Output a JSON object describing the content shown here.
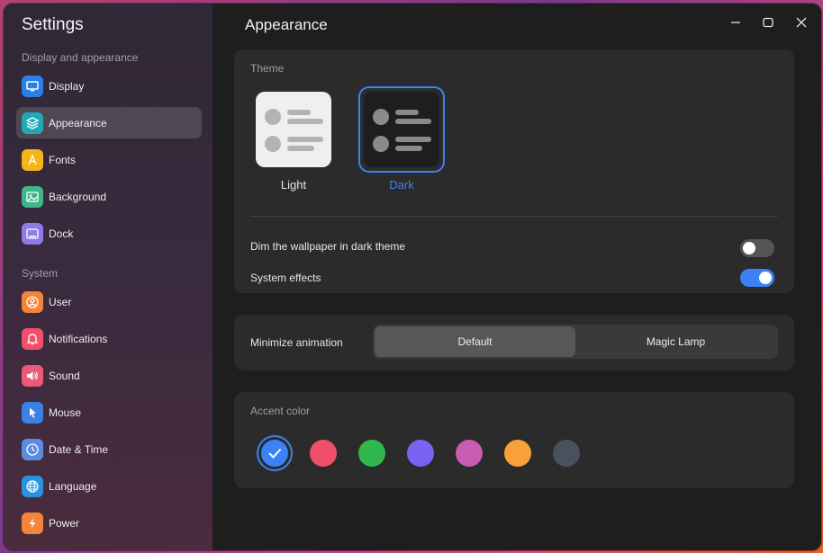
{
  "app": {
    "title": "Settings"
  },
  "sidebar": {
    "sections": [
      {
        "label": "Display and appearance"
      },
      {
        "label": "System"
      }
    ],
    "items": [
      {
        "label": "Display",
        "icon": "display-icon",
        "color": "#2b7fe8"
      },
      {
        "label": "Appearance",
        "icon": "appearance-icon",
        "color": "#1fa9b8"
      },
      {
        "label": "Fonts",
        "icon": "fonts-icon",
        "color": "#f3b51c"
      },
      {
        "label": "Background",
        "icon": "background-icon",
        "color": "#3fb58a"
      },
      {
        "label": "Dock",
        "icon": "dock-icon",
        "color": "#8d7ce6"
      },
      {
        "label": "User",
        "icon": "user-icon",
        "color": "#f2853a"
      },
      {
        "label": "Notifications",
        "icon": "bell-icon",
        "color": "#f0506a"
      },
      {
        "label": "Sound",
        "icon": "speaker-icon",
        "color": "#ec5a78"
      },
      {
        "label": "Mouse",
        "icon": "cursor-icon",
        "color": "#3b82e6"
      },
      {
        "label": "Date & Time",
        "icon": "clock-icon",
        "color": "#5c8be2"
      },
      {
        "label": "Language",
        "icon": "globe-icon",
        "color": "#2a92e0"
      },
      {
        "label": "Power",
        "icon": "power-icon",
        "color": "#f2853a"
      }
    ],
    "active": "Appearance"
  },
  "main": {
    "title": "Appearance",
    "theme": {
      "label": "Theme",
      "options": [
        {
          "name": "Light",
          "selected": false
        },
        {
          "name": "Dark",
          "selected": true
        }
      ],
      "dim_wallpaper": {
        "label": "Dim the wallpaper in dark theme",
        "on": false
      },
      "system_effects": {
        "label": "System effects",
        "on": true
      }
    },
    "minimize": {
      "label": "Minimize animation",
      "options": [
        "Default",
        "Magic Lamp"
      ],
      "selected": "Default"
    },
    "accent": {
      "label": "Accent color",
      "colors": [
        "#3b82f6",
        "#f0506a",
        "#2fb84e",
        "#7b62f5",
        "#c75cb0",
        "#f8a03a",
        "#4b5060"
      ],
      "selected_index": 0
    }
  },
  "colors": {
    "accent": "#3b82f6"
  }
}
